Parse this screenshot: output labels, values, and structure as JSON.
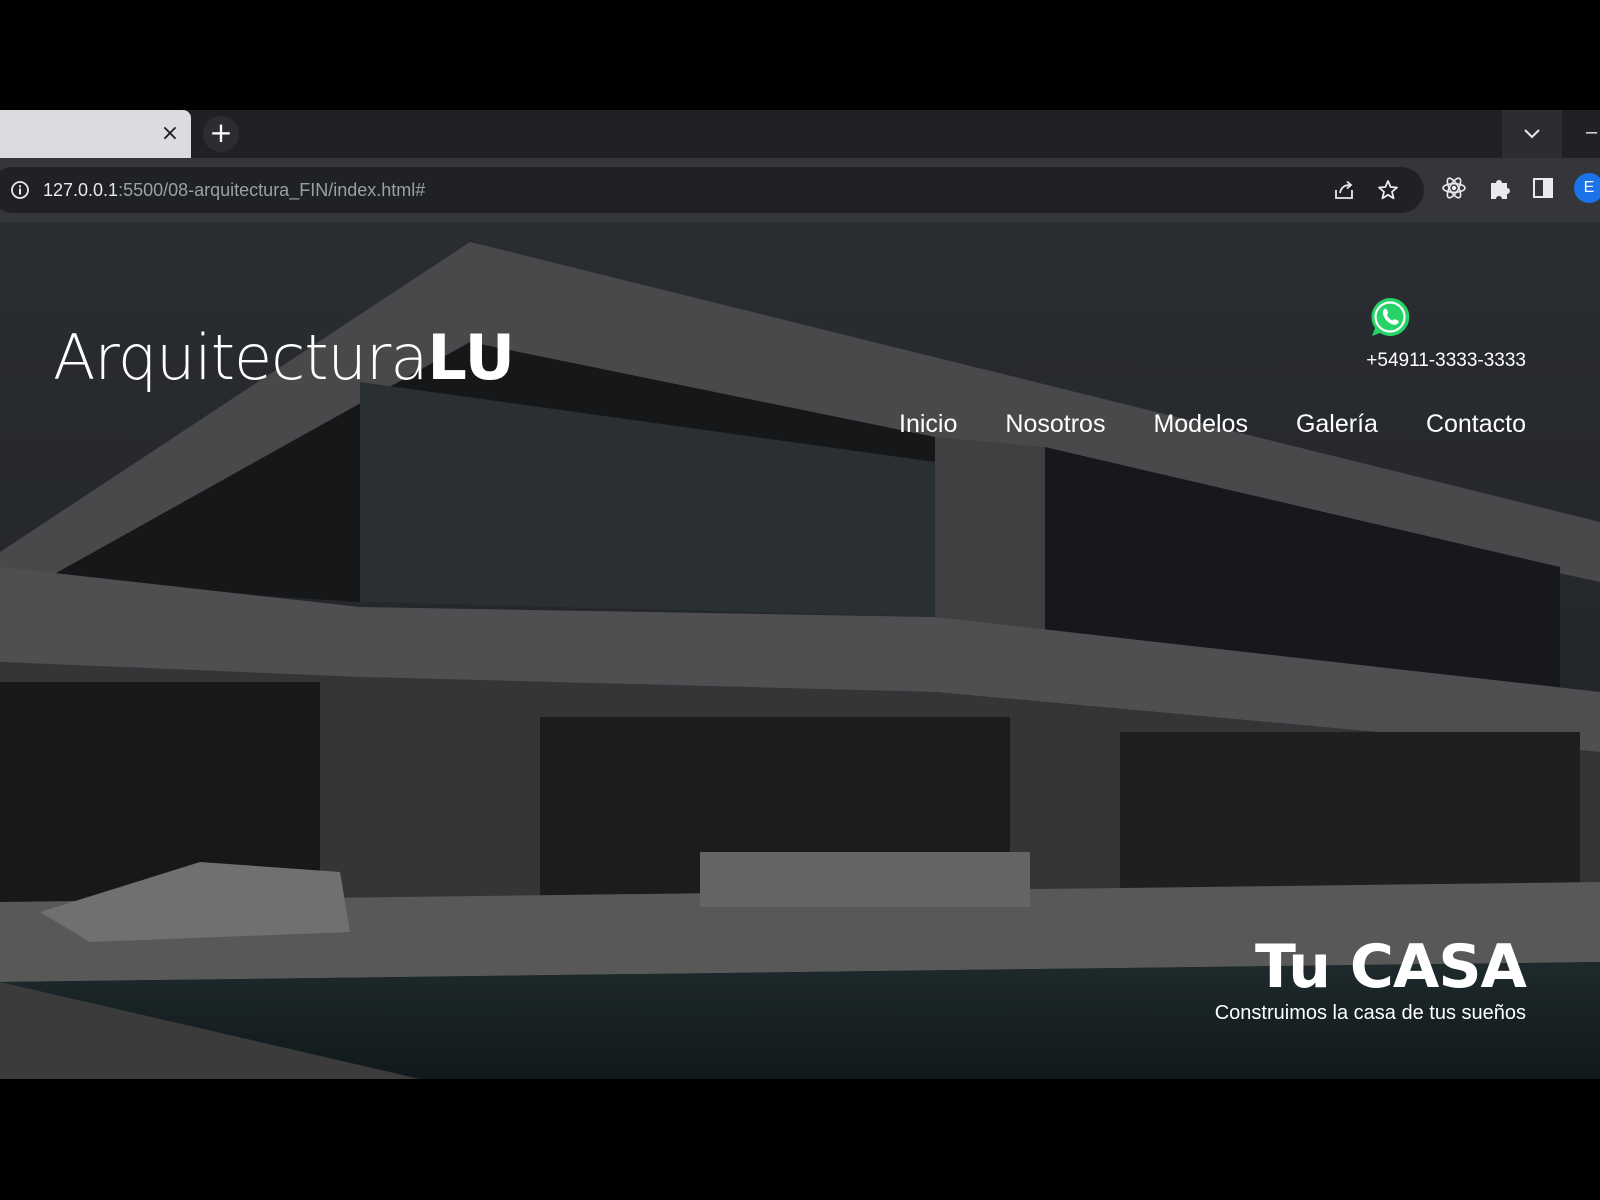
{
  "browser": {
    "tab": {
      "close_label": "×"
    },
    "new_tab_label": "+",
    "tab_search_icon": "chevron-down-icon",
    "window_minimize_label": "–",
    "address": {
      "host": "127.0.0.1",
      "path": ":5500/08-arquitectura_FIN/index.html#"
    },
    "toolbar_icons": [
      "info-icon",
      "share-icon",
      "star-icon",
      "react-devtools-icon",
      "puzzle-icon",
      "side-panel-icon"
    ],
    "profile_initial": "E"
  },
  "site": {
    "logo": {
      "light": "Arquitectura",
      "bold": "LU"
    },
    "contact": {
      "icon": "whatsapp-icon",
      "phone": "+54911-3333-3333"
    },
    "nav": [
      "Inicio",
      "Nosotros",
      "Modelos",
      "Galería",
      "Contacto"
    ],
    "hero": {
      "title": "Tu CASA",
      "subtitle": "Construimos la casa de tus sueños"
    }
  },
  "colors": {
    "chrome_dark": "#202124",
    "chrome_toolbar": "#35363a",
    "whatsapp_green": "#25d366",
    "profile_blue": "#1a73e8"
  }
}
